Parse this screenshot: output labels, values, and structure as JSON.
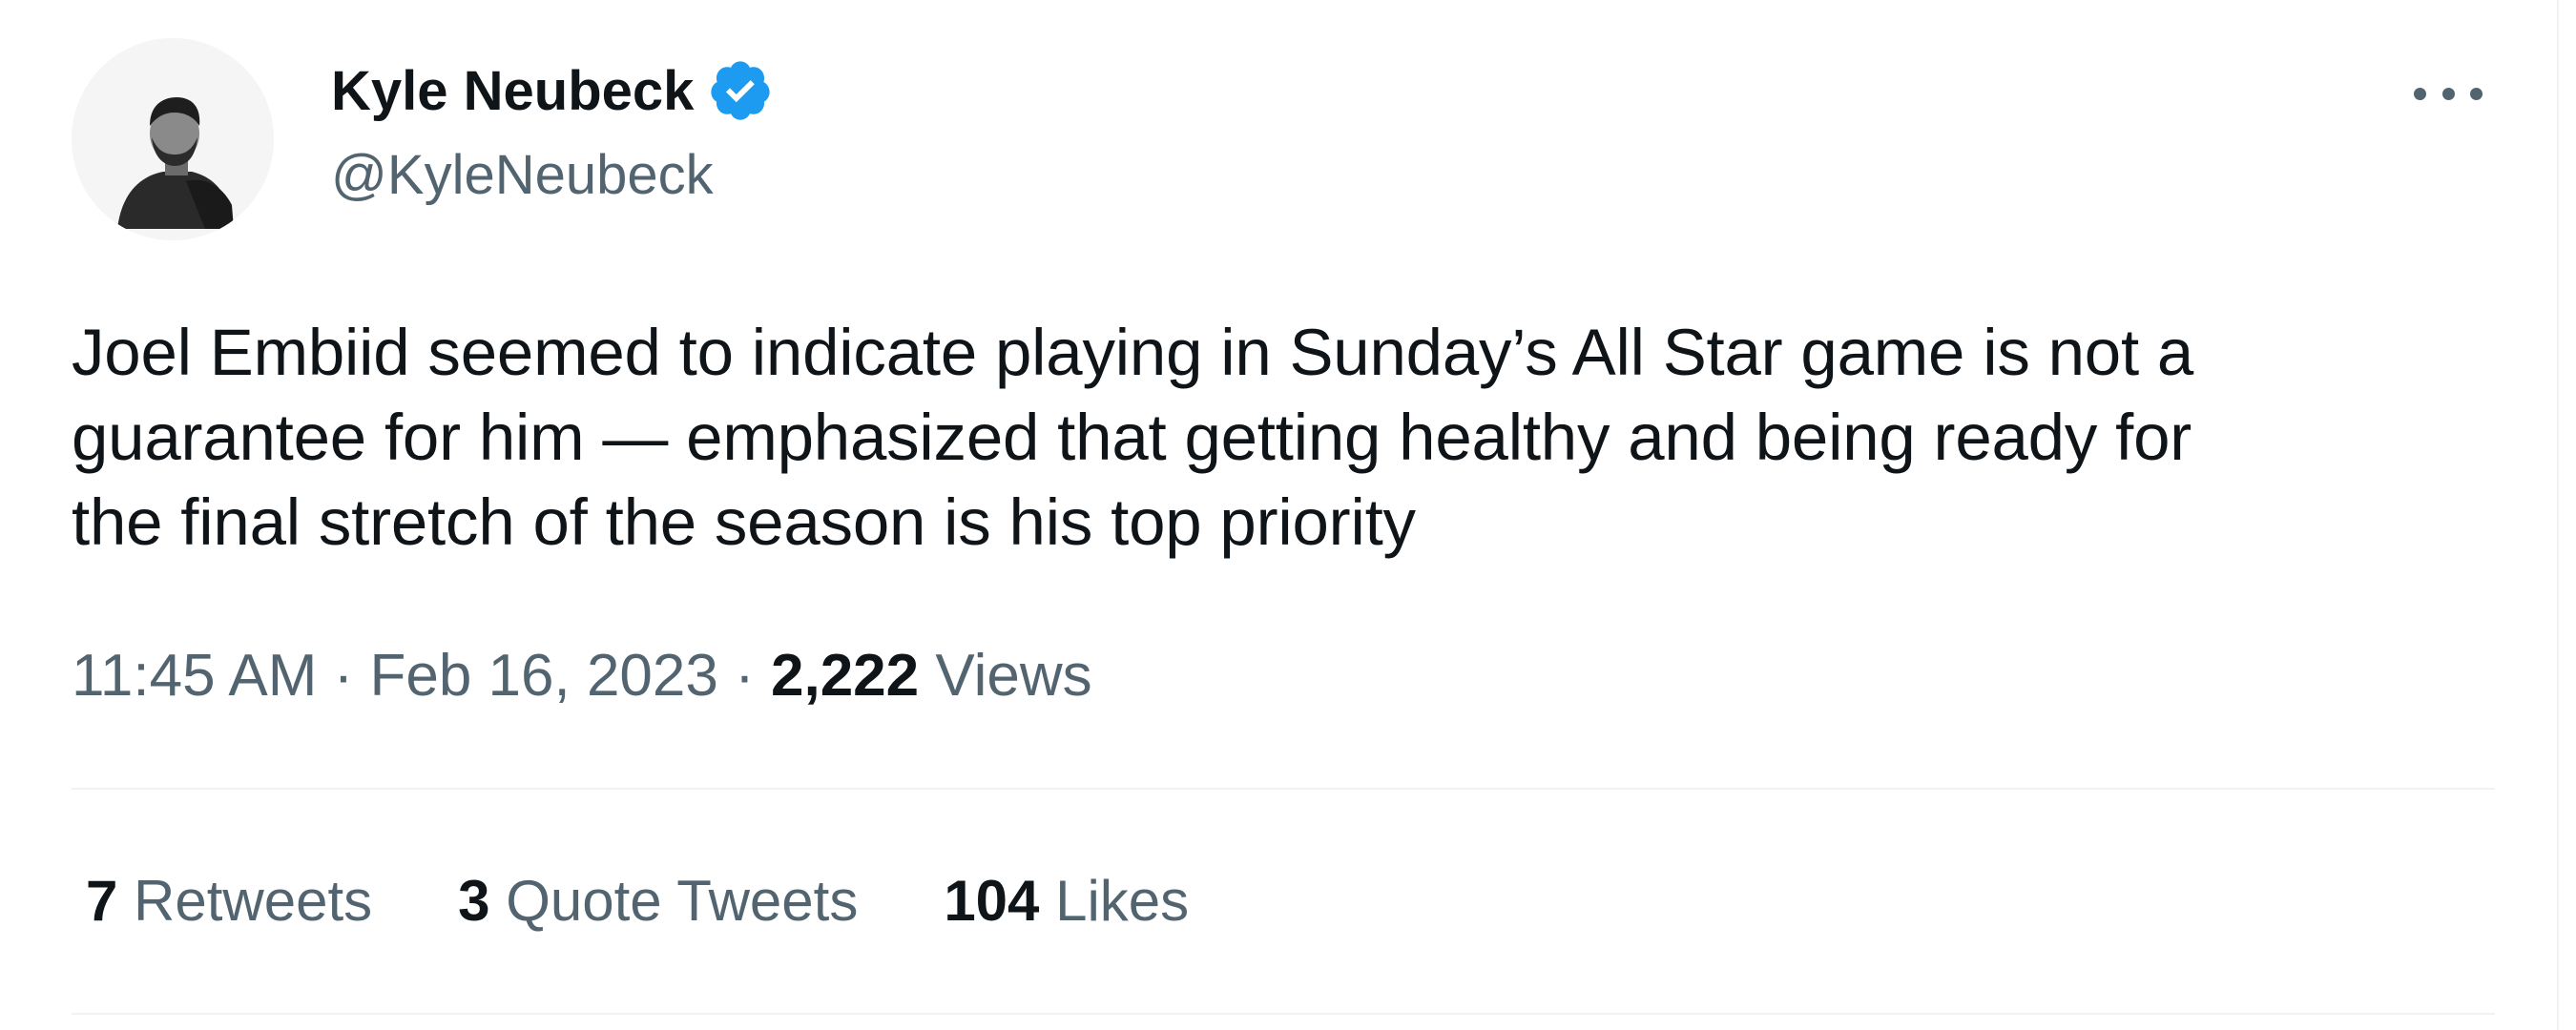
{
  "author": {
    "name": "Kyle Neubeck",
    "handle": "@KyleNeubeck",
    "verified": true,
    "avatar_icon": "profile-photo"
  },
  "menu_icon": "more-options-icon",
  "tweet": {
    "text": "Joel Embiid seemed to indicate playing in Sunday’s All Star game is not a\nguarantee for him — emphasized that getting healthy and being ready for\nthe final stretch of the season is his top priority"
  },
  "meta": {
    "time": "11:45 AM",
    "separator": " · ",
    "date": "Feb 16, 2023",
    "views_count": "2,222",
    "views_label": " Views"
  },
  "stats": {
    "retweets": {
      "count": "7",
      "label": " Retweets"
    },
    "quotes": {
      "count": "3",
      "label": " Quote Tweets"
    },
    "likes": {
      "count": "104",
      "label": " Likes"
    }
  },
  "colors": {
    "text_primary": "#0f1419",
    "text_secondary": "#536471",
    "verified_blue": "#1d9bf0",
    "divider": "#eff3f4"
  }
}
